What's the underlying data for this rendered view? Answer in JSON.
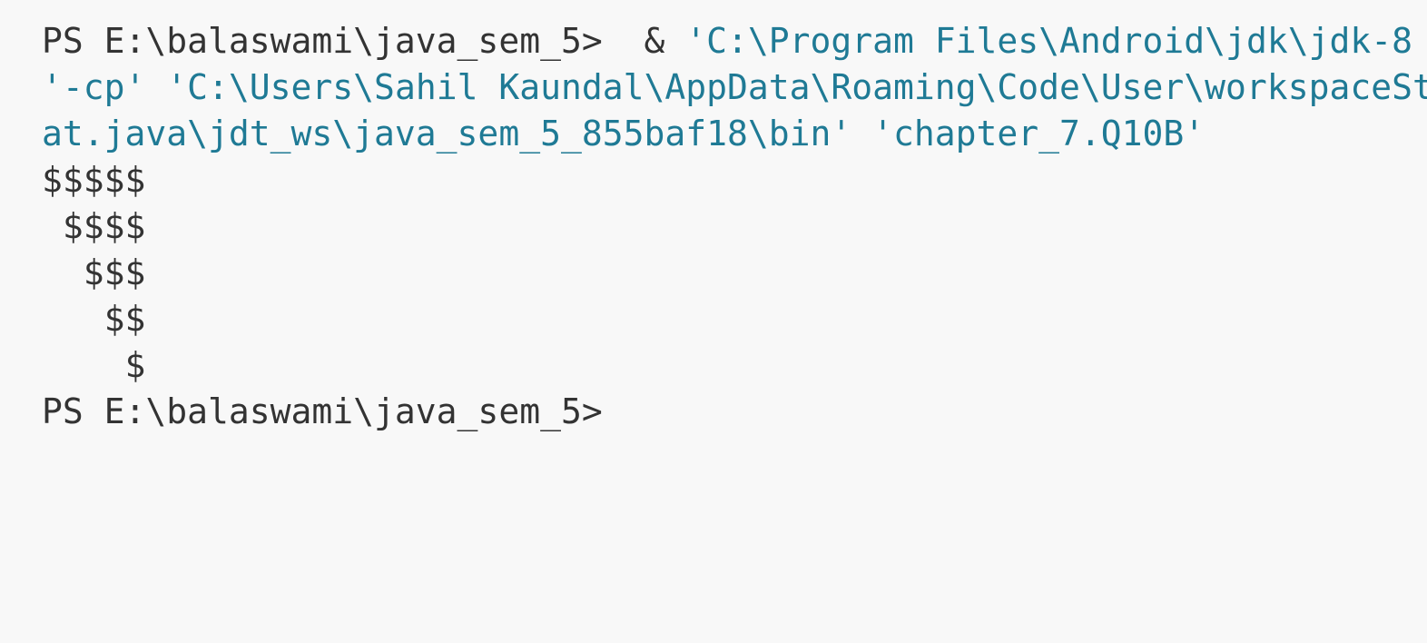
{
  "terminal": {
    "command": {
      "prompt": "PS E:\\balaswami\\java_sem_5>",
      "operator": "  & ",
      "java_path": "'C:\\Program Files\\Android\\jdk\\jdk-8",
      "classpath_flag": "'-cp'",
      "classpath_value_part1": "'C:\\Users\\Sahil Kaundal\\AppData\\Roaming\\Code\\User\\workspaceSt",
      "classpath_value_part2": "at.java\\jdt_ws\\java_sem_5_855baf18\\bin'",
      "main_class": "'chapter_7.Q10B'"
    },
    "output_lines": [
      "$$$$$",
      " $$$$",
      "  $$$",
      "   $$",
      "    $"
    ],
    "final_prompt": "PS E:\\balaswami\\java_sem_5>"
  },
  "colors": {
    "background": "#f8f8f8",
    "text": "#333333",
    "string": "#1f7a95"
  }
}
